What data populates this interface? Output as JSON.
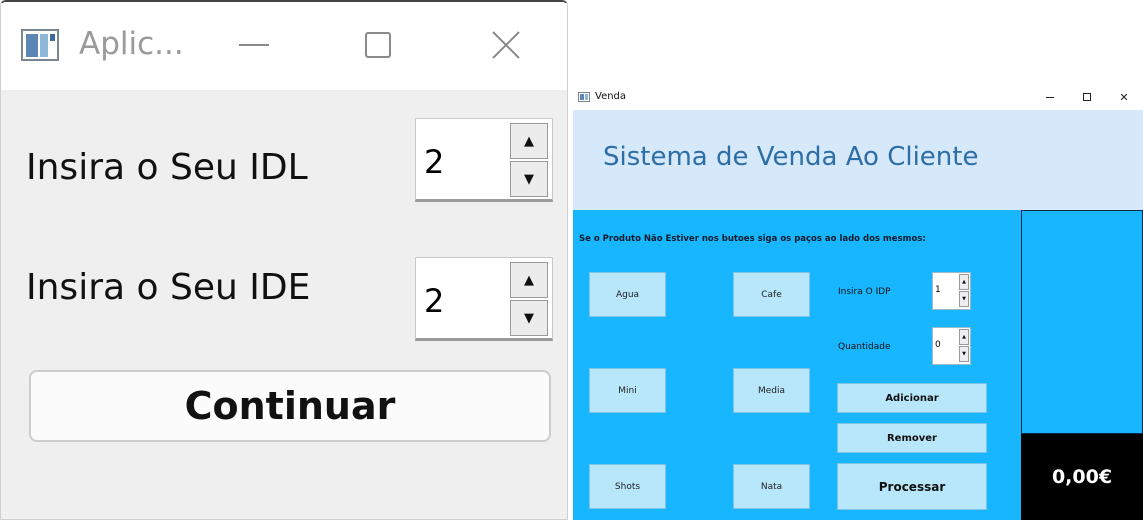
{
  "dialog": {
    "title": "Aplic...",
    "icon": "app-window-icon",
    "fields": [
      {
        "label": "Insira o Seu IDL",
        "value": "2"
      },
      {
        "label": "Insira o Seu IDE",
        "value": "2"
      }
    ],
    "continue_label": "Continuar",
    "spin_up_glyph": "▲",
    "spin_down_glyph": "▼"
  },
  "venda": {
    "title": "Venda",
    "header_title": "Sistema de Venda Ao Cliente",
    "instruction": "Se o Produto Não Estiver nos butoes siga os paços ao lado dos mesmos:",
    "products": [
      "Agua",
      "Cafe",
      "Mini",
      "Media",
      "Shots",
      "Nata"
    ],
    "idp_label": "Insira O IDP",
    "idp_value": "1",
    "quantity_label": "Quantidade",
    "quantity_value": "0",
    "add_label": "Adicionar",
    "remove_label": "Remover",
    "process_label": "Processar",
    "total": "0,00€",
    "close_glyph": "✕",
    "spin_up_glyph": "▲",
    "spin_down_glyph": "▼"
  },
  "colors": {
    "venda_background": "#17b6ff",
    "header_background": "#d5e9fb",
    "header_text": "#2e6ea6",
    "button_background": "#b8e6fb",
    "total_background": "#000000"
  }
}
